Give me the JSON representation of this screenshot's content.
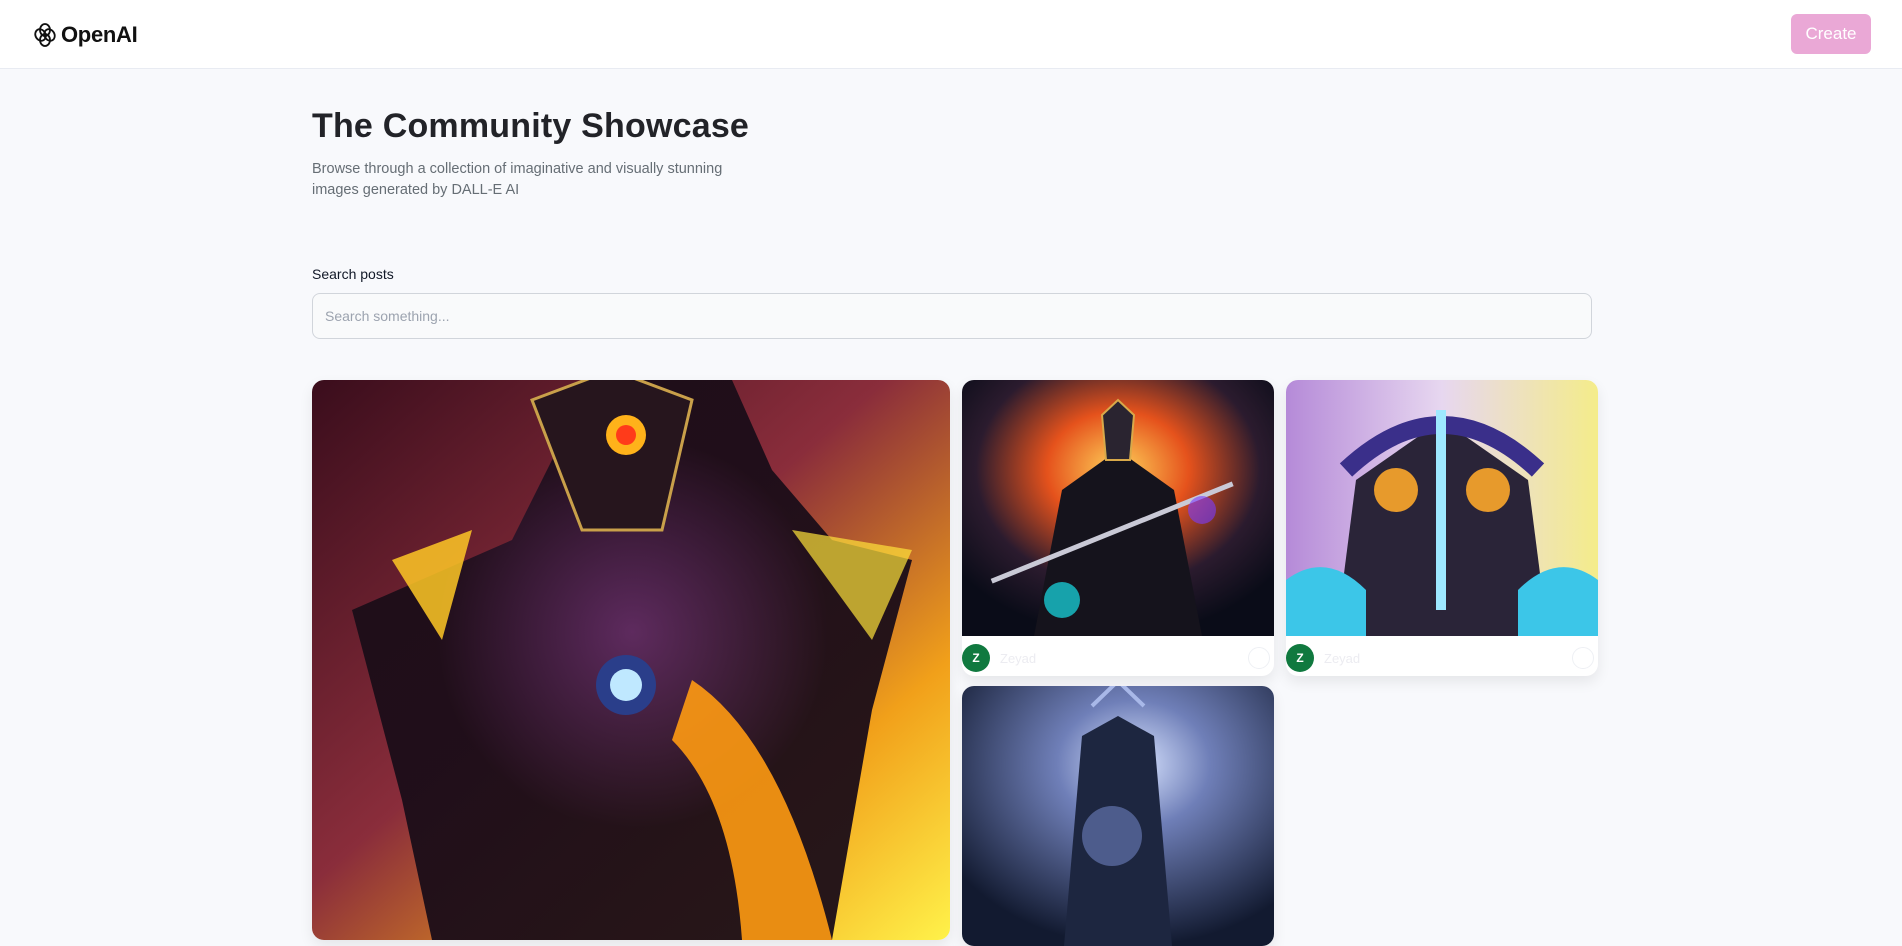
{
  "header": {
    "logo_text": "OpenAI",
    "create_label": "Create"
  },
  "page": {
    "title": "The Community Showcase",
    "subtitle": "Browse through a collection of imaginative and visually stunning images generated by DALL-E AI"
  },
  "search": {
    "label": "Search posts",
    "placeholder": "Search something...",
    "value": ""
  },
  "posts": [
    {
      "author": "",
      "avatar_letter": ""
    },
    {
      "author": "Zeyad",
      "avatar_letter": "Z"
    },
    {
      "author": "Zeyad",
      "avatar_letter": "Z"
    },
    {
      "author": "",
      "avatar_letter": ""
    }
  ],
  "colors": {
    "accent": "#eaa8d6",
    "avatar_bg": "#10793f",
    "background": "#f8f9fc"
  }
}
